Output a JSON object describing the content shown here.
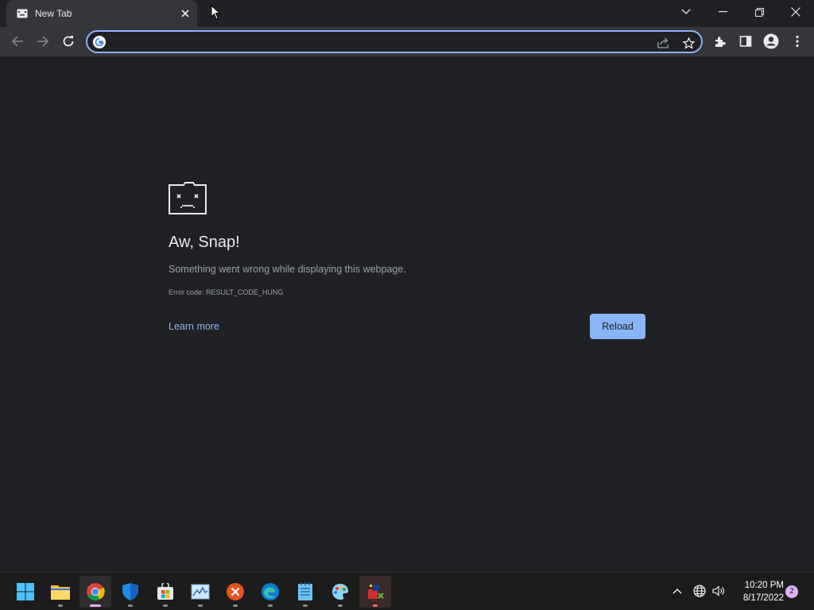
{
  "tab": {
    "title": "New Tab",
    "favicon": "sad-tab-icon"
  },
  "window_controls": [
    "tab-search-icon",
    "minimize-icon",
    "restore-icon",
    "close-icon"
  ],
  "toolbar": {
    "icons": [
      "back-arrow-icon",
      "forward-arrow-icon",
      "reload-icon",
      "share-icon",
      "star-icon",
      "extensions-icon",
      "side-panel-icon",
      "profile-icon",
      "menu-icon"
    ],
    "omnibox": {
      "value": "",
      "placeholder": ""
    }
  },
  "error_page": {
    "title": "Aw, Snap!",
    "message": "Something went wrong while displaying this webpage.",
    "error_code": "Error code: RESULT_CODE_HUNG",
    "learn_more": "Learn more",
    "reload": "Reload"
  },
  "taskbar": {
    "apps": [
      "start",
      "file-explorer",
      "chrome",
      "windows-security",
      "microsoft-store",
      "task-manager",
      "x-app",
      "edge",
      "notepad",
      "paint",
      "app"
    ],
    "clock": {
      "time": "10:20 PM",
      "date": "8/17/2022"
    },
    "notifications": "2"
  },
  "colors": {
    "accent": "#8ab4f8",
    "background": "#202124",
    "toolbar": "#35363a"
  }
}
